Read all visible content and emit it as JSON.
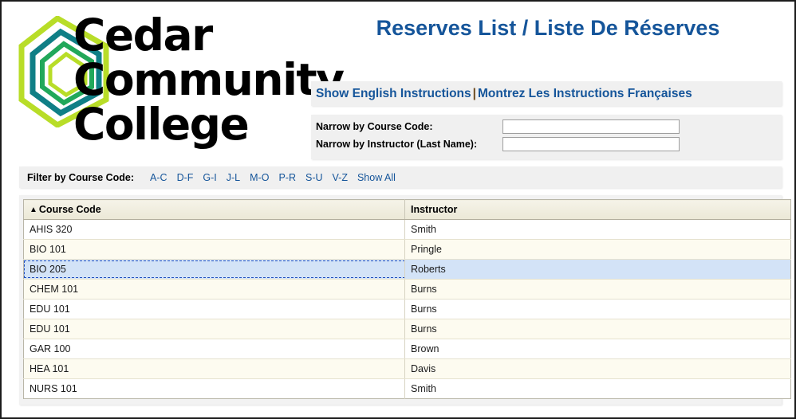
{
  "logo": {
    "mark_name": "cedar-community-college-hexagon-logo",
    "lines": [
      "Cedar",
      "Community",
      "College"
    ],
    "colors": {
      "ring_outer": "#b8dd28",
      "ring_second": "#0f7f86",
      "ring_third": "#21a85a",
      "ring_inner": "#b8dd28"
    }
  },
  "header": {
    "title": "Reserves List / Liste De Réserves",
    "title_color": "#15559a"
  },
  "instructions": {
    "english_label": "Show English Instructions",
    "separator": "|",
    "french_label": "Montrez Les Instructions Françaises"
  },
  "narrow": {
    "course_label": "Narrow by Course Code:",
    "course_value": "",
    "course_placeholder": "",
    "instructor_label": "Narrow by Instructor (Last Name):",
    "instructor_value": "",
    "instructor_placeholder": ""
  },
  "filter": {
    "label": "Filter by Course Code:",
    "links": [
      "A-C",
      "D-F",
      "G-I",
      "J-L",
      "M-O",
      "P-R",
      "S-U",
      "V-Z",
      "Show All"
    ]
  },
  "table": {
    "sort_indicator": "▲",
    "sort_column": "Course Code",
    "columns": [
      "Course Code",
      "Instructor"
    ],
    "rows": [
      {
        "course": "AHIS 320",
        "instructor": "Smith"
      },
      {
        "course": "BIO 101",
        "instructor": "Pringle"
      },
      {
        "course": "BIO 205",
        "instructor": "Roberts"
      },
      {
        "course": "CHEM 101",
        "instructor": "Burns"
      },
      {
        "course": "EDU 101",
        "instructor": "Burns"
      },
      {
        "course": "EDU 101",
        "instructor": "Burns"
      },
      {
        "course": "GAR 100",
        "instructor": "Brown"
      },
      {
        "course": "HEA 101",
        "instructor": "Davis"
      },
      {
        "course": "NURS 101",
        "instructor": "Smith"
      }
    ],
    "selected_row_index": 2,
    "selected_row_color": "#d3e3f7",
    "focus_outline_color": "#1f4fbf"
  }
}
